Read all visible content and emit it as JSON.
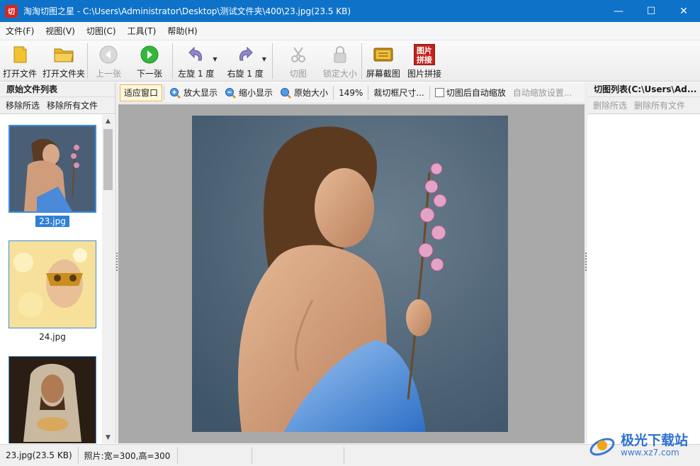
{
  "window": {
    "app_icon_text": "切",
    "title": "淘淘切图之星 - C:\\Users\\Administrator\\Desktop\\测试文件夹\\400\\23.jpg(23.5 KB)",
    "controls": {
      "minimize": "—",
      "maximize": "☐",
      "close": "✕"
    }
  },
  "menu": [
    "文件(F)",
    "视图(V)",
    "切图(C)",
    "工具(T)",
    "帮助(H)"
  ],
  "toolbar": {
    "open_file": "打开文件",
    "open_folder": "打开文件夹",
    "prev": "上一张",
    "next": "下一张",
    "rotate_left": "左旋 1 度",
    "rotate_right": "右旋 1 度",
    "cut": "切图",
    "lock_size": "锁定大小",
    "screenshot": "屏幕截图",
    "stitch": "图片拼接",
    "stitch_icon_text": "图片拼接"
  },
  "left_panel": {
    "title": "原始文件列表",
    "remove_selected": "移除所选",
    "remove_all": "移除所有文件",
    "files": [
      {
        "name": "23.jpg",
        "selected": true
      },
      {
        "name": "24.jpg",
        "selected": false
      },
      {
        "name": "",
        "selected": false
      }
    ]
  },
  "view_toolbar": {
    "fit_window": "适应窗口",
    "zoom_in": "放大显示",
    "zoom_out": "缩小显示",
    "original_size": "原始大小",
    "zoom_level": "149%",
    "crop_size": "裁切框尺寸...",
    "auto_zoom_after_cut": "切图后自动缩放",
    "auto_zoom_settings": "自动缩放设置..."
  },
  "right_panel": {
    "title": "切图列表(C:\\Users\\Ad...",
    "delete_selected": "删除所选",
    "delete_all": "删除所有文件"
  },
  "status": {
    "file": "23.jpg(23.5 KB)",
    "dimensions": "照片:宽=300,高=300"
  },
  "watermark": {
    "brand": "极光下载站",
    "url": "www.xz7.com"
  },
  "colors": {
    "titlebar": "#0f72c9",
    "selection": "#2f7fd8",
    "canvas_bg": "#a9a9a9"
  }
}
